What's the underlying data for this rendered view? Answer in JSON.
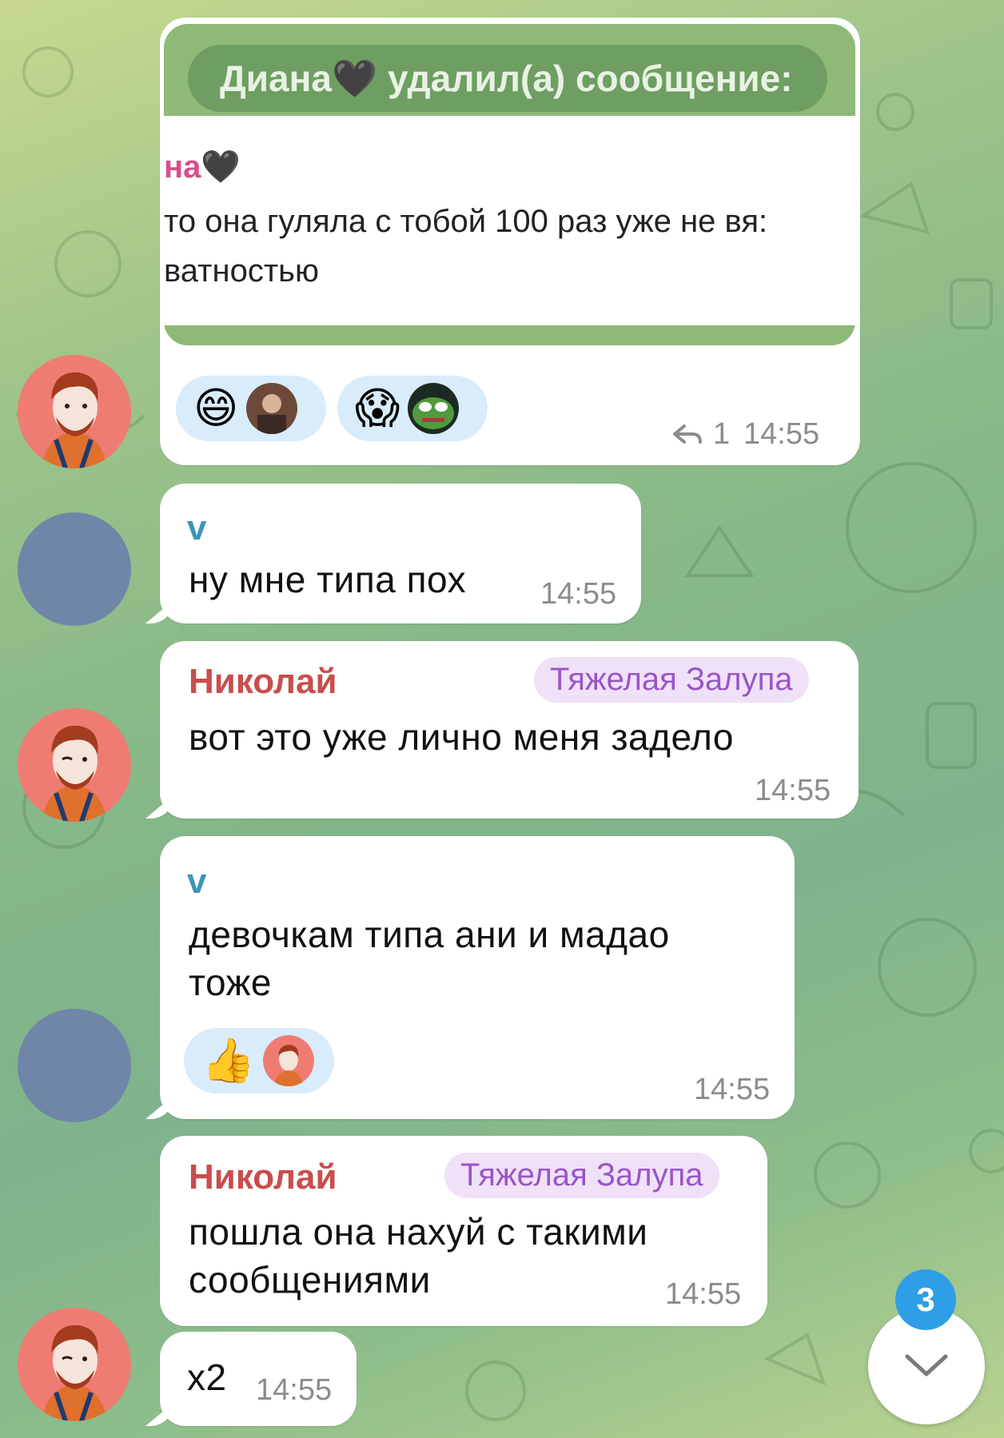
{
  "messages": {
    "m1": {
      "screenshot": {
        "header": "Диана🖤 удалил(а) сообщение:",
        "name": "на🖤",
        "line1": "то она гуляла с тобой 100 раз уже не вя:",
        "line2": "ватностью"
      },
      "reactions": [
        {
          "emoji": "😄",
          "avatar": "user-avatar"
        },
        {
          "emoji": "😱",
          "avatar": "pepe-avatar"
        }
      ],
      "replies": "1",
      "time": "14:55"
    },
    "m2": {
      "sender": "v",
      "text": "ну мне типа пох",
      "time": "14:55"
    },
    "m3": {
      "sender": "Николай",
      "badge": "Тяжелая Залупа",
      "text": "вот это уже лично меня задело",
      "time": "14:55"
    },
    "m4": {
      "sender": "v",
      "text_line1": "девочкам типа ани и мадао",
      "text_line2": "тоже",
      "reaction": {
        "emoji": "👍",
        "avatar": "user-avatar"
      },
      "time": "14:55"
    },
    "m5": {
      "sender": "Николай",
      "badge": "Тяжелая Залупа",
      "text_line1": "пошла она нахуй с такими",
      "text_line2": "сообщениями",
      "time": "14:55"
    },
    "m6": {
      "text": "x2",
      "time": "14:55"
    }
  },
  "scroll_down": {
    "unread_count": "3",
    "icon": "chevron-down-icon"
  },
  "colors": {
    "sender_v": "#3d95b5",
    "sender_nikolai": "#c94d4d",
    "badge_text": "#9a55c8",
    "badge_bg": "#efe1f8",
    "counter": "#2e9ee6"
  }
}
